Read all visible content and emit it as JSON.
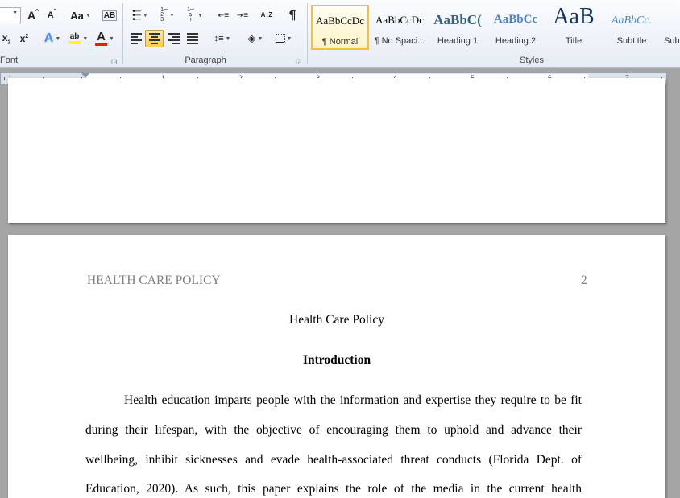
{
  "ribbon": {
    "groups": {
      "font": "Font",
      "paragraph": "Paragraph",
      "styles": "Styles"
    },
    "font_controls": {
      "grow_font": "A",
      "shrink_font": "A",
      "change_case": "Aa",
      "subscript": "x",
      "subscript_mark": "2",
      "superscript": "x",
      "superscript_mark": "2",
      "text_effects": "A",
      "highlight": "ab",
      "font_color": "A"
    },
    "paragraph_controls": {
      "sort": "A↓Z",
      "show_marks": "¶"
    },
    "styles": [
      {
        "sample": "AaBbCcDc",
        "name": "¶ Normal"
      },
      {
        "sample": "AaBbCcDc",
        "name": "¶ No Spaci..."
      },
      {
        "sample": "AaBbC(",
        "name": "Heading 1"
      },
      {
        "sample": "AaBbCc",
        "name": "Heading 2"
      },
      {
        "sample": "AaB",
        "name": "Title"
      },
      {
        "sample": "AaBbCc.",
        "name": "Subtitle"
      },
      {
        "sample": "",
        "name": "Sub"
      }
    ]
  },
  "ruler": {
    "numbers": [
      "1",
      "1",
      "2",
      "3",
      "4",
      "5",
      "6",
      "7"
    ]
  },
  "document": {
    "header_left": "HEALTH CARE POLICY",
    "page_number": "2",
    "title": "Health Care Policy",
    "heading": "Introduction",
    "body_lines": [
      "Health education imparts people with the information and expertise they require to be fit",
      "during their lifespan, with the objective of encouraging them to uphold and advance their",
      "wellbeing, inhibit sicknesses and evade health-associated threat conducts (Florida Dept. of",
      "Education, 2020). As such, this paper explains the role of the media in the current health"
    ]
  },
  "colors": {
    "selected_fill": "#f9cd55",
    "text_effects": "#4f8fe0",
    "highlight": "#ffff00",
    "font_color": "#e02020",
    "heading1": "#365f91",
    "heading2": "#4f81bd"
  }
}
